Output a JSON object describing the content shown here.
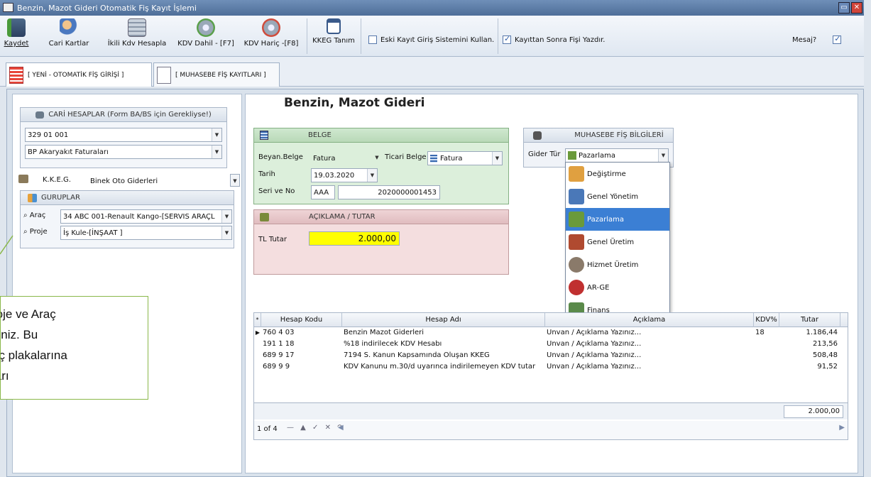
{
  "window": {
    "title": "Benzin, Mazot Gideri Otomatik Fiş Kayıt İşlemi"
  },
  "toolbar": {
    "buttons": [
      {
        "label": "Kaydet",
        "icon": "save-icon"
      },
      {
        "label": "Cari Kartlar",
        "icon": "users-icon"
      },
      {
        "label": "İkili Kdv Hesapla",
        "icon": "calculator-icon"
      },
      {
        "label": "KDV Dahil - [F7]",
        "icon": "gear-icon"
      },
      {
        "label": "KDV Hariç -[F8]",
        "icon": "gear-icon"
      },
      {
        "label": "KKEG Tanım",
        "icon": "window-icon"
      }
    ],
    "eski_kayit": {
      "label": "Eski Kayıt Giriş Sistemini Kullan.",
      "checked": false
    },
    "fis_yazdir": {
      "label": "Kayıttan Sonra Fişi Yazdır.",
      "checked": true
    },
    "mesaj": {
      "label": "Mesaj?",
      "checked": true
    }
  },
  "tabs": [
    {
      "label": "[ YENİ - OTOMATİK FİŞ GİRİŞİ ]"
    },
    {
      "label": "[ MUHASEBE FİŞ KAYITLARI ]"
    }
  ],
  "left": {
    "cari_header": "CARİ HESAPLAR (Form BA/BS için Gerekliyse!)",
    "cari_code": "329 01 001",
    "cari_name": "BP Akaryakıt Faturaları",
    "kkeg_label": "K.K.E.G.",
    "kkeg_value": "Binek Oto Giderleri",
    "guruplar_header": "GURUPLAR",
    "arac_label": "Araç",
    "arac_value": "34 ABC 001-Renault Kango-[SERVİS ARAÇL",
    "proje_label": "Proje",
    "proje_value": "İş Kule-[İNŞAAT ]"
  },
  "main": {
    "title": "Benzin, Mazot Gideri",
    "belge": {
      "header": "BELGE",
      "beyan_label": "Beyan.Belge",
      "beyan_value": "Fatura",
      "ticari_label": "Ticari Belge",
      "ticari_value": "Fatura",
      "tarih_label": "Tarih",
      "tarih_value": "19.03.2020",
      "seri_label": "Seri ve No",
      "seri_value": "AAA",
      "no_value": "2020000001453"
    },
    "aciklama": {
      "header": "AÇIKLAMA / TUTAR",
      "tl_label": "TL Tutar",
      "tl_value": "2.000,00"
    },
    "muhasebe": {
      "header": "MUHASEBE FİŞ BİLGİLERİ",
      "gider_label": "Gider Tür",
      "gider_value": "Pazarlama",
      "options": [
        {
          "label": "Değiştirme",
          "icon": "hand-icon",
          "color": "#e0a040"
        },
        {
          "label": "Genel Yönetim",
          "icon": "building-icon",
          "color": "#4a78b8"
        },
        {
          "label": "Pazarlama",
          "icon": "store-icon",
          "color": "#6a9a3a"
        },
        {
          "label": "Genel Üretim",
          "icon": "factory-icon",
          "color": "#b04a30"
        },
        {
          "label": "Hizmet Üretim",
          "icon": "person-icon",
          "color": "#8a7a6a"
        },
        {
          "label": "AR-GE",
          "icon": "flask-icon",
          "color": "#c03030"
        },
        {
          "label": "Finans",
          "icon": "money-icon",
          "color": "#5a8a4a"
        }
      ],
      "selected": "Pazarlama"
    },
    "grid": {
      "columns": [
        "Hesap Kodu",
        "Hesap Adı",
        "Açıklama",
        "KDV%",
        "Tutar"
      ],
      "rows": [
        {
          "kod": "760 4 03",
          "ad": "Benzin Mazot Giderleri",
          "aciklama": "Unvan / Açıklama Yazınız...",
          "kdv": "18",
          "tutar": "1.186,44"
        },
        {
          "kod": "191 1 18",
          "ad": "%18 indirilecek KDV Hesabı",
          "aciklama": "Unvan / Açıklama Yazınız...",
          "kdv": "",
          "tutar": "213,56"
        },
        {
          "kod": "689 9 17",
          "ad": "7194 S. Kanun Kapsamında Oluşan KKEG",
          "aciklama": "Unvan / Açıklama Yazınız...",
          "kdv": "",
          "tutar": "508,48"
        },
        {
          "kod": "689 9 9",
          "ad": "KDV Kanunu m.30/d uyarınca indirilemeyen KDV tutar",
          "aciklama": "Unvan / Açıklama Yazınız...",
          "kdv": "",
          "tutar": "91,52"
        }
      ],
      "total": "2.000,00",
      "pager": "1 of 4"
    }
  },
  "callout": {
    "lines": [
      "roje ve Araç",
      "siniz. Bu",
      "aç plakalarına",
      "ları"
    ]
  }
}
